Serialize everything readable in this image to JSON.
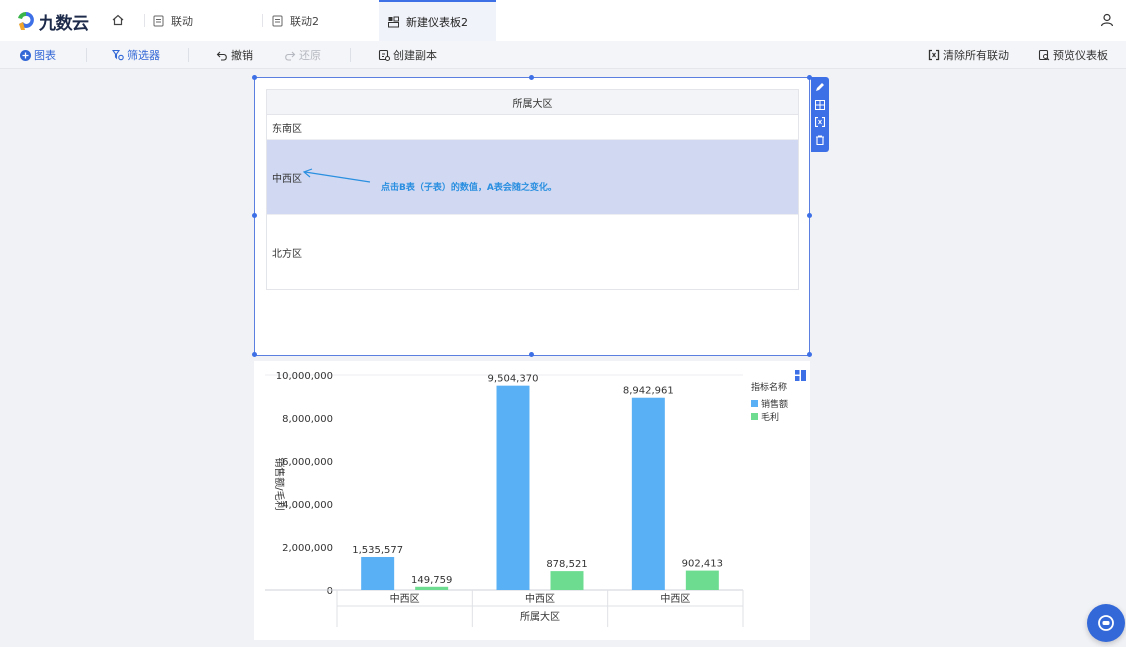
{
  "app": {
    "logo_text": "九数云"
  },
  "tabs": [
    {
      "label": "联动",
      "active": false
    },
    {
      "label": "联动2",
      "active": false
    },
    {
      "label": "新建仪表板2",
      "active": true
    }
  ],
  "toolbar": {
    "chart_label": "图表",
    "filter_label": "筛选器",
    "undo_label": "撤销",
    "redo_label": "还原",
    "copy_label": "创建副本",
    "clear_links_label": "清除所有联动",
    "preview_label": "预览仪表板"
  },
  "table_widget": {
    "header": "所属大区",
    "rows": [
      "东南区",
      "中西区",
      "北方区"
    ],
    "selected_row": 1,
    "annotation": "点击B表（子表）的数值，A表会随之变化。"
  },
  "chart_data": {
    "type": "bar",
    "categories": [
      "中西区",
      "中西区",
      "中西区"
    ],
    "xlabel": "所属大区",
    "ylabel": "销售额/毛利",
    "ylim": [
      0,
      10000000
    ],
    "yticks": [
      "0",
      "2,000,000",
      "4,000,000",
      "6,000,000",
      "8,000,000",
      "10,000,000"
    ],
    "legend_title": "指标名称",
    "legend_position": "right",
    "series": [
      {
        "name": "销售额",
        "color": "#5ab0f4",
        "values": [
          1535577,
          9504370,
          8942961
        ],
        "labels": [
          "1,535,577",
          "9,504,370",
          "8,942,961"
        ]
      },
      {
        "name": "毛利",
        "color": "#6ddc90",
        "values": [
          149759,
          878521,
          902413
        ],
        "labels": [
          "149,759",
          "878,521",
          "902,413"
        ]
      }
    ]
  },
  "colors": {
    "accent": "#3d6fe6",
    "selected_row": "#d1d9f2",
    "annotation": "#2a8fe0"
  }
}
